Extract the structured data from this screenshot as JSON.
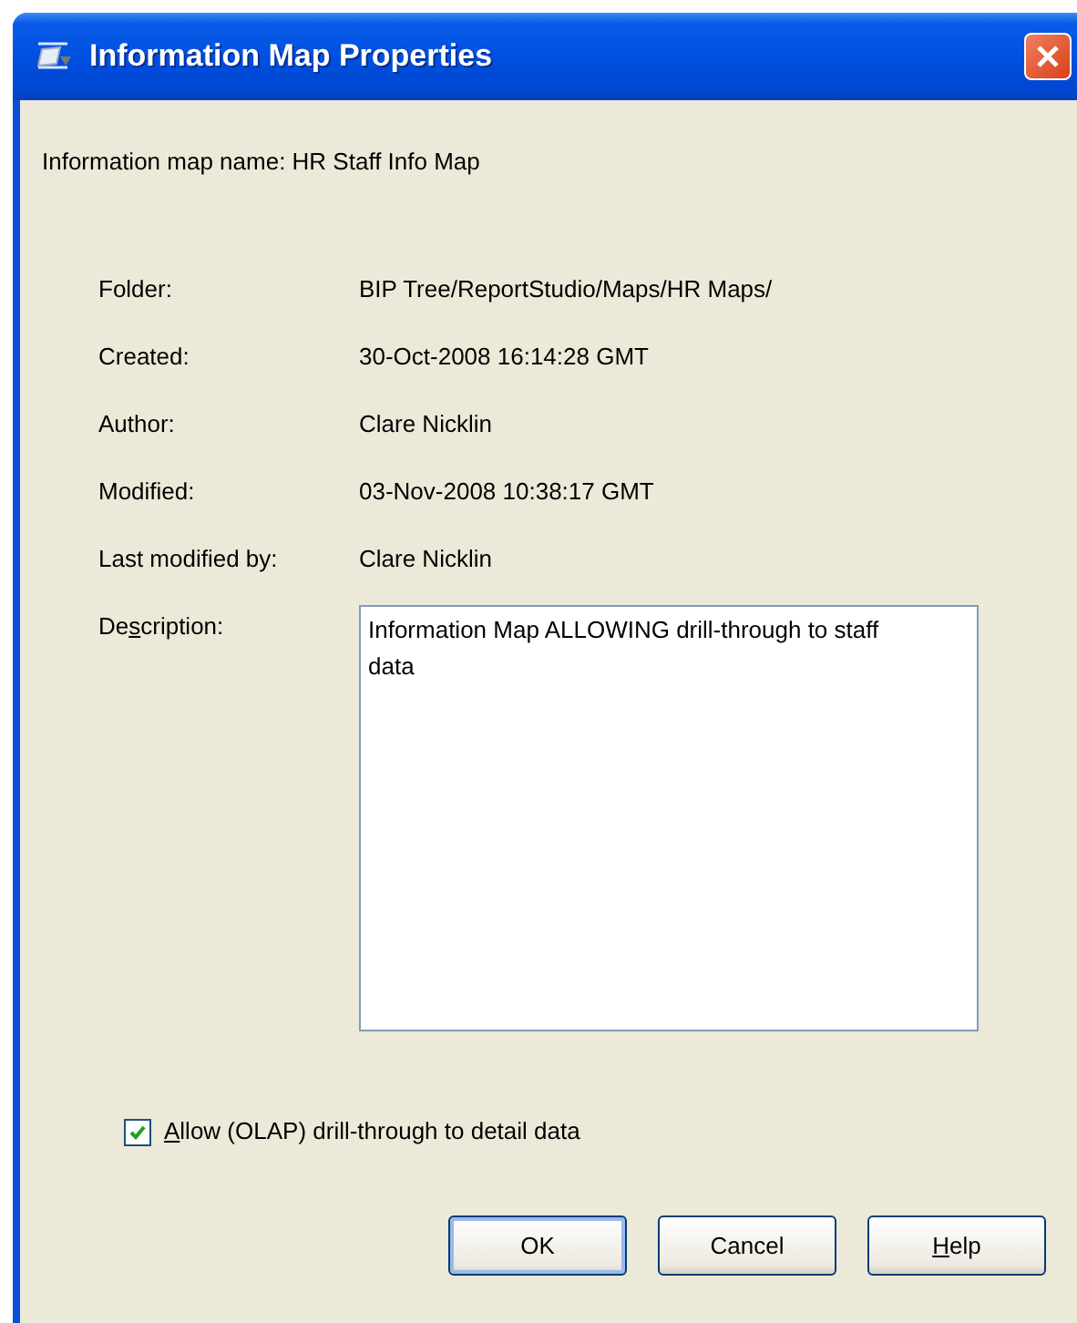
{
  "window": {
    "title": "Information Map Properties"
  },
  "map_name": "Information map name: HR Staff Info Map",
  "properties": [
    {
      "label": "Folder:",
      "value": "BIP Tree/ReportStudio/Maps/HR Maps/"
    },
    {
      "label": "Created:",
      "value": "30-Oct-2008 16:14:28 GMT"
    },
    {
      "label": "Author:",
      "value": "Clare Nicklin"
    },
    {
      "label": "Modified:",
      "value": "03-Nov-2008 10:38:17 GMT"
    },
    {
      "label": "Last modified by:",
      "value": "Clare Nicklin"
    }
  ],
  "description": {
    "label": {
      "before": "De",
      "key": "s",
      "after": "cription:"
    },
    "value": "Information Map ALLOWING drill-through to staff data"
  },
  "allow_drill_through": {
    "label": {
      "key": "A",
      "after": "llow (OLAP) drill-through to detail data"
    },
    "checked": true
  },
  "buttons": [
    {
      "label": {
        "before": "OK"
      },
      "default": true
    },
    {
      "label": {
        "before": "Cancel"
      },
      "default": false
    },
    {
      "label": {
        "key": "H",
        "after": "elp"
      },
      "default": false
    }
  ]
}
